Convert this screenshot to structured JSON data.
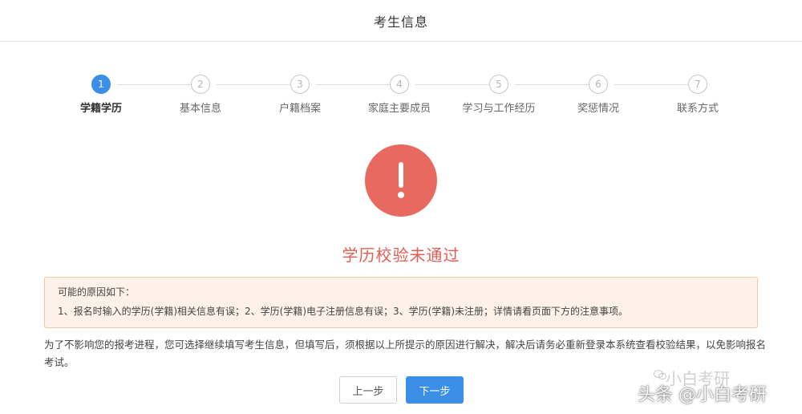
{
  "header": {
    "title": "考生信息"
  },
  "steps": [
    {
      "number": "1",
      "label": "学籍学历",
      "active": true
    },
    {
      "number": "2",
      "label": "基本信息",
      "active": false
    },
    {
      "number": "3",
      "label": "户籍档案",
      "active": false
    },
    {
      "number": "4",
      "label": "家庭主要成员",
      "active": false
    },
    {
      "number": "5",
      "label": "学习与工作经历",
      "active": false
    },
    {
      "number": "6",
      "label": "奖惩情况",
      "active": false
    },
    {
      "number": "7",
      "label": "联系方式",
      "active": false
    }
  ],
  "result": {
    "icon": "exclamation-icon",
    "title": "学历校验未通过",
    "color": "#e8695f"
  },
  "alert": {
    "heading": "可能的原因如下：",
    "reasons": "1、报名时输入的学历(学籍)相关信息有误；2、学历(学籍)电子注册信息有误；3、学历(学籍)未注册；详情请看页面下方的注意事项。"
  },
  "notice": "为了不影响您的报考进程，您可选择继续填写考生信息，但填写后，须根据以上所提示的原因进行解决，解决后请务必重新登录本系统查看校验结果，以免影响报名考试。",
  "buttons": {
    "prev": "上一步",
    "next": "下一步"
  },
  "watermark": {
    "faint": "小白考研",
    "main": "头条 @小白考研"
  },
  "colors": {
    "accent": "#3b8fe6",
    "error": "#e25d53"
  }
}
